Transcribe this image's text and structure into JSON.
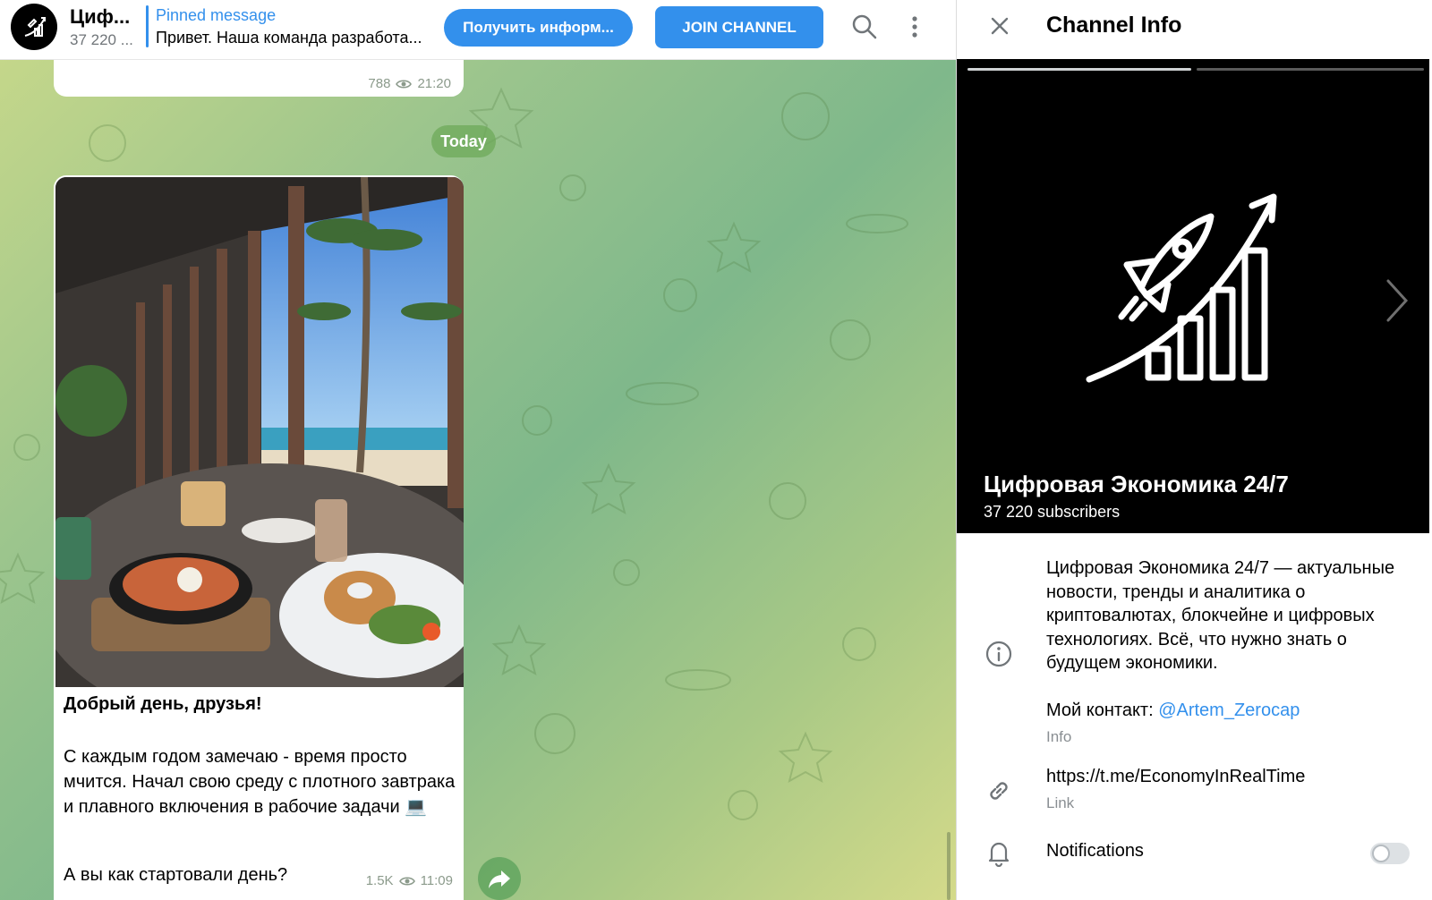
{
  "header": {
    "channel_name": "Циф...",
    "subscribers_short": "37 220 ...",
    "pinned_title": "Pinned message",
    "pinned_text": "Привет. Наша команда разработа...",
    "info_button": "Получить информ...",
    "join_button": "JOIN CHANNEL"
  },
  "previous_message": {
    "views": "788",
    "time": "21:20"
  },
  "date_divider": "Today",
  "message": {
    "title": "Добрый день, друзья!",
    "body": "С каждым годом замечаю - время просто мчится. Начал свою среду с плотного завтрака и плавного включения в рабочие задачи 💻",
    "question": "А вы как стартовали день?",
    "views": "1.5K",
    "time": "11:09"
  },
  "panel": {
    "title": "Channel Info",
    "channel_full_name": "Цифровая Экономика 24/7",
    "subscribers": "37 220 subscribers",
    "description": "Цифровая Экономика 24/7 — актуальные новости, тренды и аналитика о криптовалютах, блокчейне и цифровых технологиях. Всё, что нужно знать о будущем экономики.",
    "contact_label": "Мой контакт: ",
    "contact_handle": "@Artem_Zerocap",
    "info_caption": "Info",
    "link_url": "https://t.me/EconomyInRealTime",
    "link_caption": "Link",
    "notifications_label": "Notifications",
    "notifications_enabled": false
  },
  "colors": {
    "accent": "#3390ec",
    "chat_bg_green": "#9cc58d",
    "cover_bg": "#000000"
  },
  "icons": [
    "search-icon",
    "more-vertical-icon",
    "eye-icon",
    "share-icon",
    "close-icon",
    "chevron-right-icon",
    "info-icon",
    "link-icon",
    "bell-icon"
  ]
}
